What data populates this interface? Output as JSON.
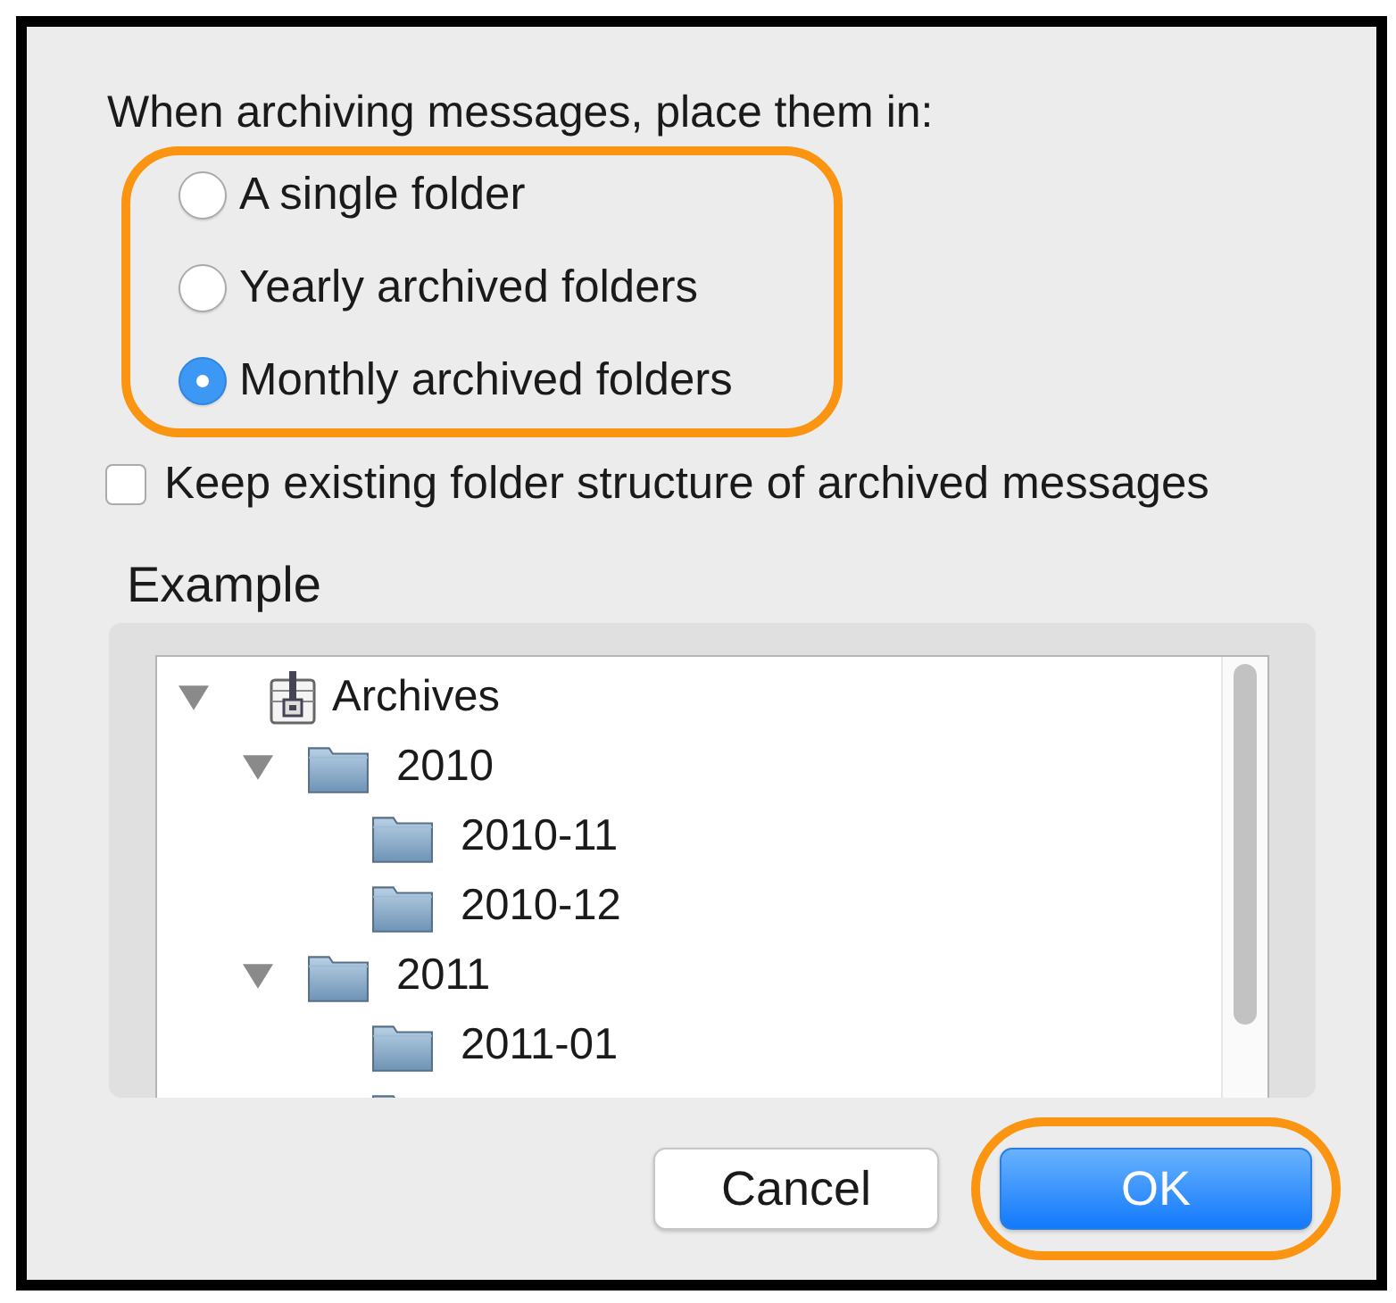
{
  "prompt": "When archiving messages, place them in:",
  "placement": {
    "highlighted": true,
    "options": [
      {
        "label": "A single folder",
        "selected": false
      },
      {
        "label": "Yearly archived folders",
        "selected": false
      },
      {
        "label": "Monthly archived folders",
        "selected": true
      }
    ]
  },
  "keep_structure": {
    "label": "Keep existing folder structure of archived messages",
    "checked": false
  },
  "example": {
    "title": "Example",
    "tree": [
      {
        "label": "Archives",
        "kind": "archive",
        "expanded": true,
        "children": [
          {
            "label": "2010",
            "kind": "folder",
            "expanded": true,
            "children": [
              {
                "label": "2010-11",
                "kind": "folder"
              },
              {
                "label": "2010-12",
                "kind": "folder"
              }
            ]
          },
          {
            "label": "2011",
            "kind": "folder",
            "expanded": true,
            "children": [
              {
                "label": "2011-01",
                "kind": "folder"
              },
              {
                "kind": "folder"
              }
            ]
          }
        ]
      }
    ]
  },
  "buttons": [
    {
      "label": "Cancel",
      "kind": "secondary",
      "highlighted": false
    },
    {
      "label": "OK",
      "kind": "default",
      "highlighted": true
    }
  ]
}
